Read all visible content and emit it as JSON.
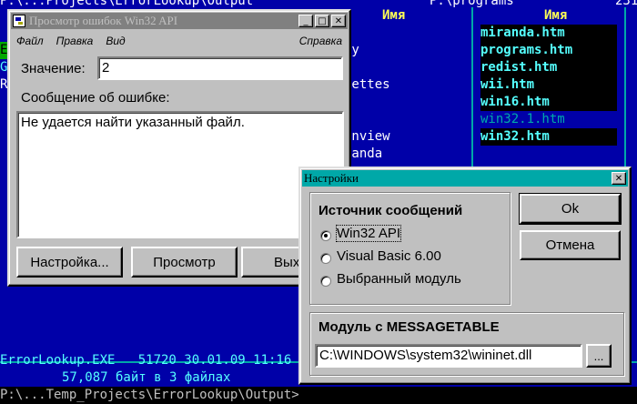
{
  "background": {
    "top_left_fragment": "P:\\...Projects\\ErrorLookup\\Output",
    "top_mid_fragment": "P:\\programs",
    "top_right_fragment": "231",
    "name_header_left": "Имя",
    "name_header_right": "Имя",
    "left_column_items": [
      "ky",
      "a",
      "kettes",
      "",
      "",
      "anview",
      "randa",
      "s"
    ],
    "right_column_items": [
      "miranda.htm",
      "programs.htm",
      "redist.htm",
      "wii.htm",
      "win16.htm",
      "win32.1.htm",
      "win32.htm"
    ],
    "status_line": "ErrorLookup.EXE   51720 30.01.09 11:16",
    "summary_line": "57,087 байт в 3 файлах",
    "command_line": "P:\\...Temp_Projects\\ErrorLookup\\Output>",
    "left_edge_fragments": [
      "E",
      "Gr",
      "Rr"
    ]
  },
  "main_window": {
    "title": "Просмотр ошибок Win32 API",
    "menu": [
      "Файл",
      "Правка",
      "Вид"
    ],
    "menu_help": "Справка",
    "value_label": "Значение:",
    "value": "2",
    "message_label": "Сообщение об ошибке:",
    "message_text": "Не удается найти указанный файл.",
    "buttons": {
      "settings": "Настройка...",
      "view": "Просмотр",
      "exit": "Выход"
    }
  },
  "settings_dialog": {
    "title": "Настройки",
    "source_group_label": "Источник сообщений",
    "options": [
      "Win32 API",
      "Visual Basic 6.00",
      "Выбранный модуль"
    ],
    "selected_option": "Win32 API",
    "ok_label": "Ok",
    "cancel_label": "Отмена",
    "module_group_label": "Модуль с MESSAGETABLE",
    "module_path": "C:\\WINDOWS\\system32\\wininet.dll",
    "browse_label": "..."
  }
}
